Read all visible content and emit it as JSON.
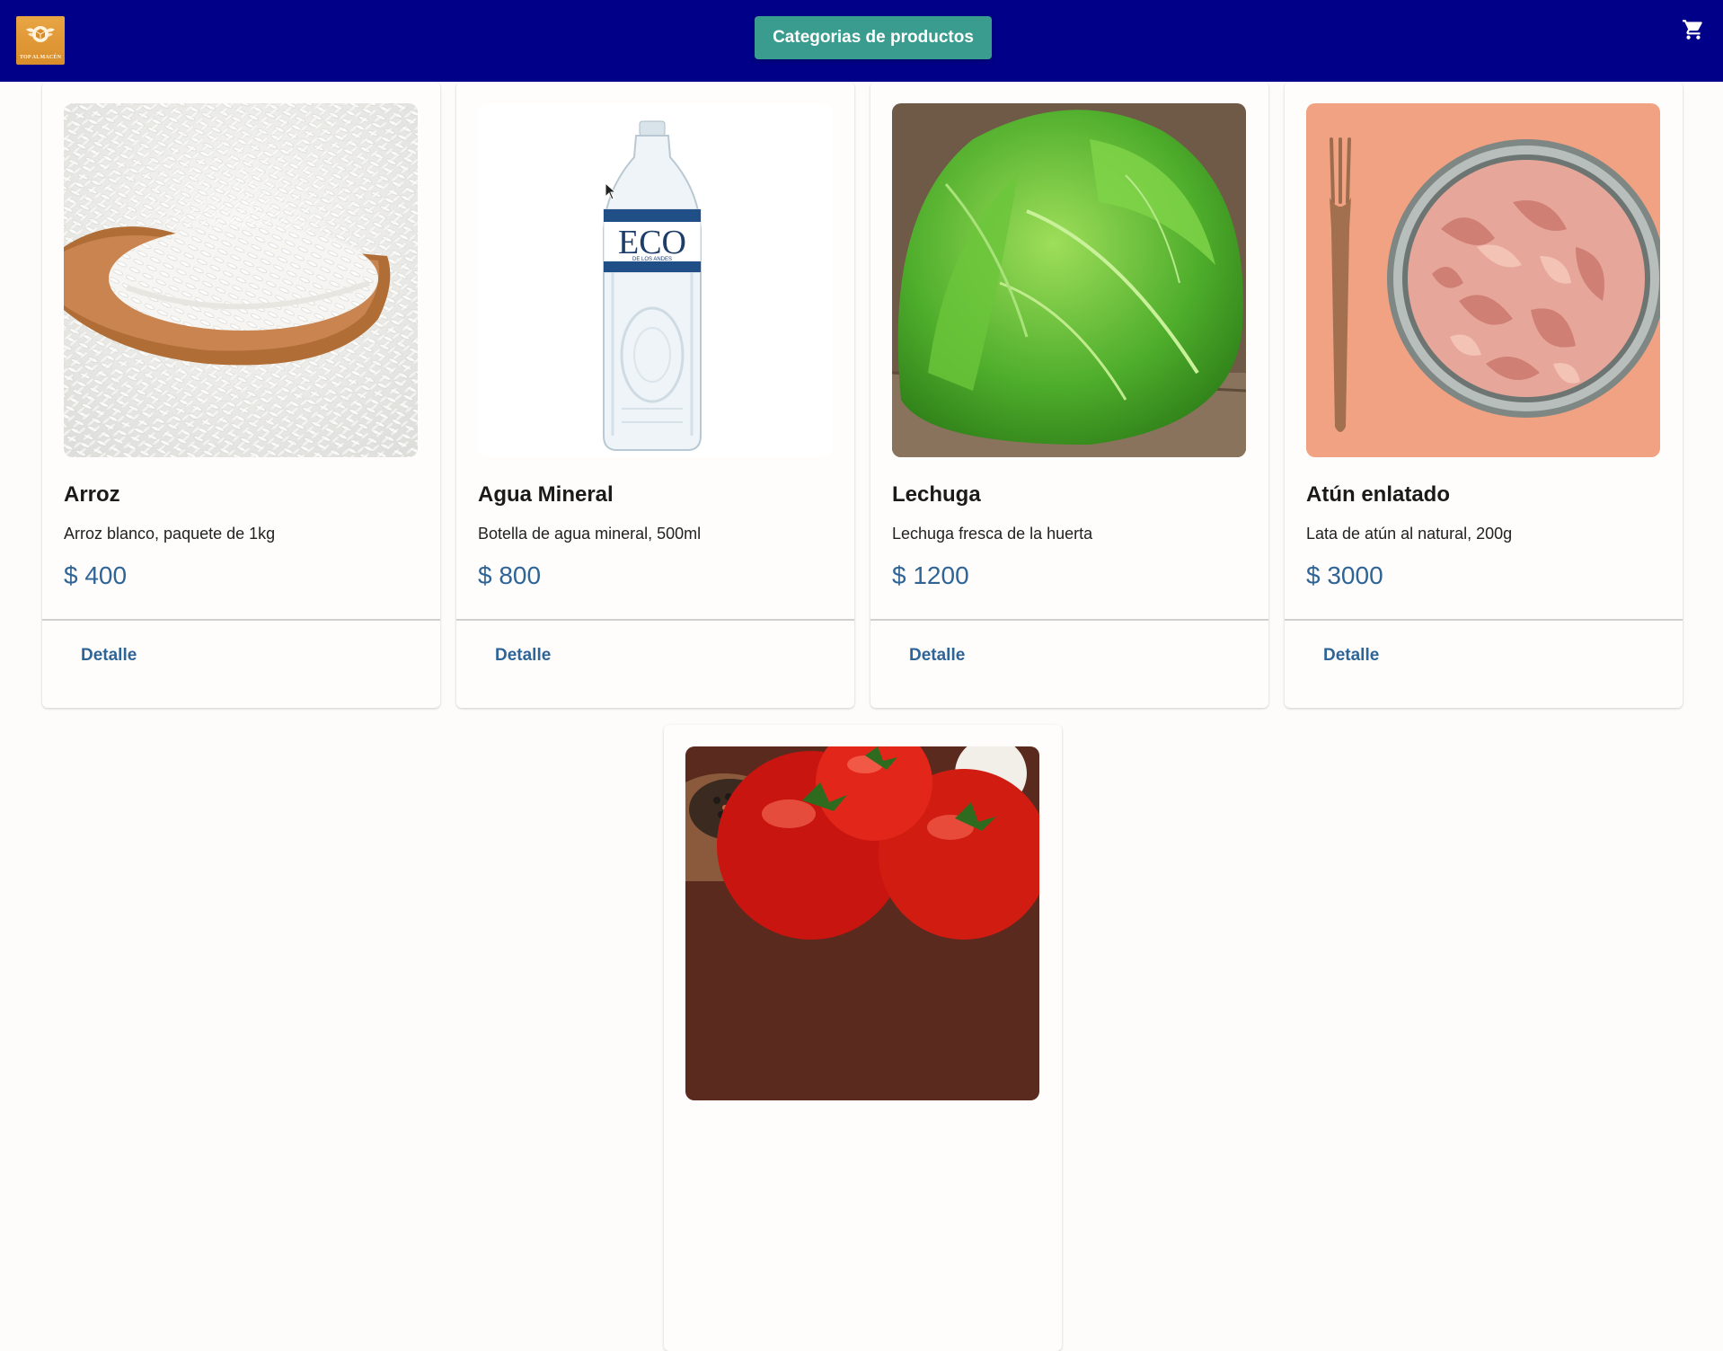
{
  "navbar": {
    "logo_text": "TOP ALMACÉN",
    "categories_button_label": "Categorias de productos",
    "cart_icon": "shopping-cart-icon",
    "background_color": "#000088",
    "button_color": "#3a9c8f"
  },
  "products": [
    {
      "name": "Arroz",
      "description": "Arroz blanco, paquete de 1kg",
      "price": "$ 400",
      "detail_label": "Detalle",
      "image": "rice-image"
    },
    {
      "name": "Agua Mineral",
      "description": "Botella de agua mineral, 500ml",
      "price": "$ 800",
      "detail_label": "Detalle",
      "image": "water-bottle-image",
      "bottle_brand": "ECO",
      "bottle_subtext": "DE LOS ANDES"
    },
    {
      "name": "Lechuga",
      "description": "Lechuga fresca de la huerta",
      "price": "$ 1200",
      "detail_label": "Detalle",
      "image": "lettuce-image"
    },
    {
      "name": "Atún enlatado",
      "description": "Lata de atún al natural, 200g",
      "price": "$ 3000",
      "detail_label": "Detalle",
      "image": "canned-tuna-image"
    },
    {
      "name": "",
      "description": "",
      "price": "",
      "detail_label": "",
      "image": "tomatoes-image"
    }
  ],
  "colors": {
    "price": "#2f6497",
    "accent": "#2f6497"
  }
}
